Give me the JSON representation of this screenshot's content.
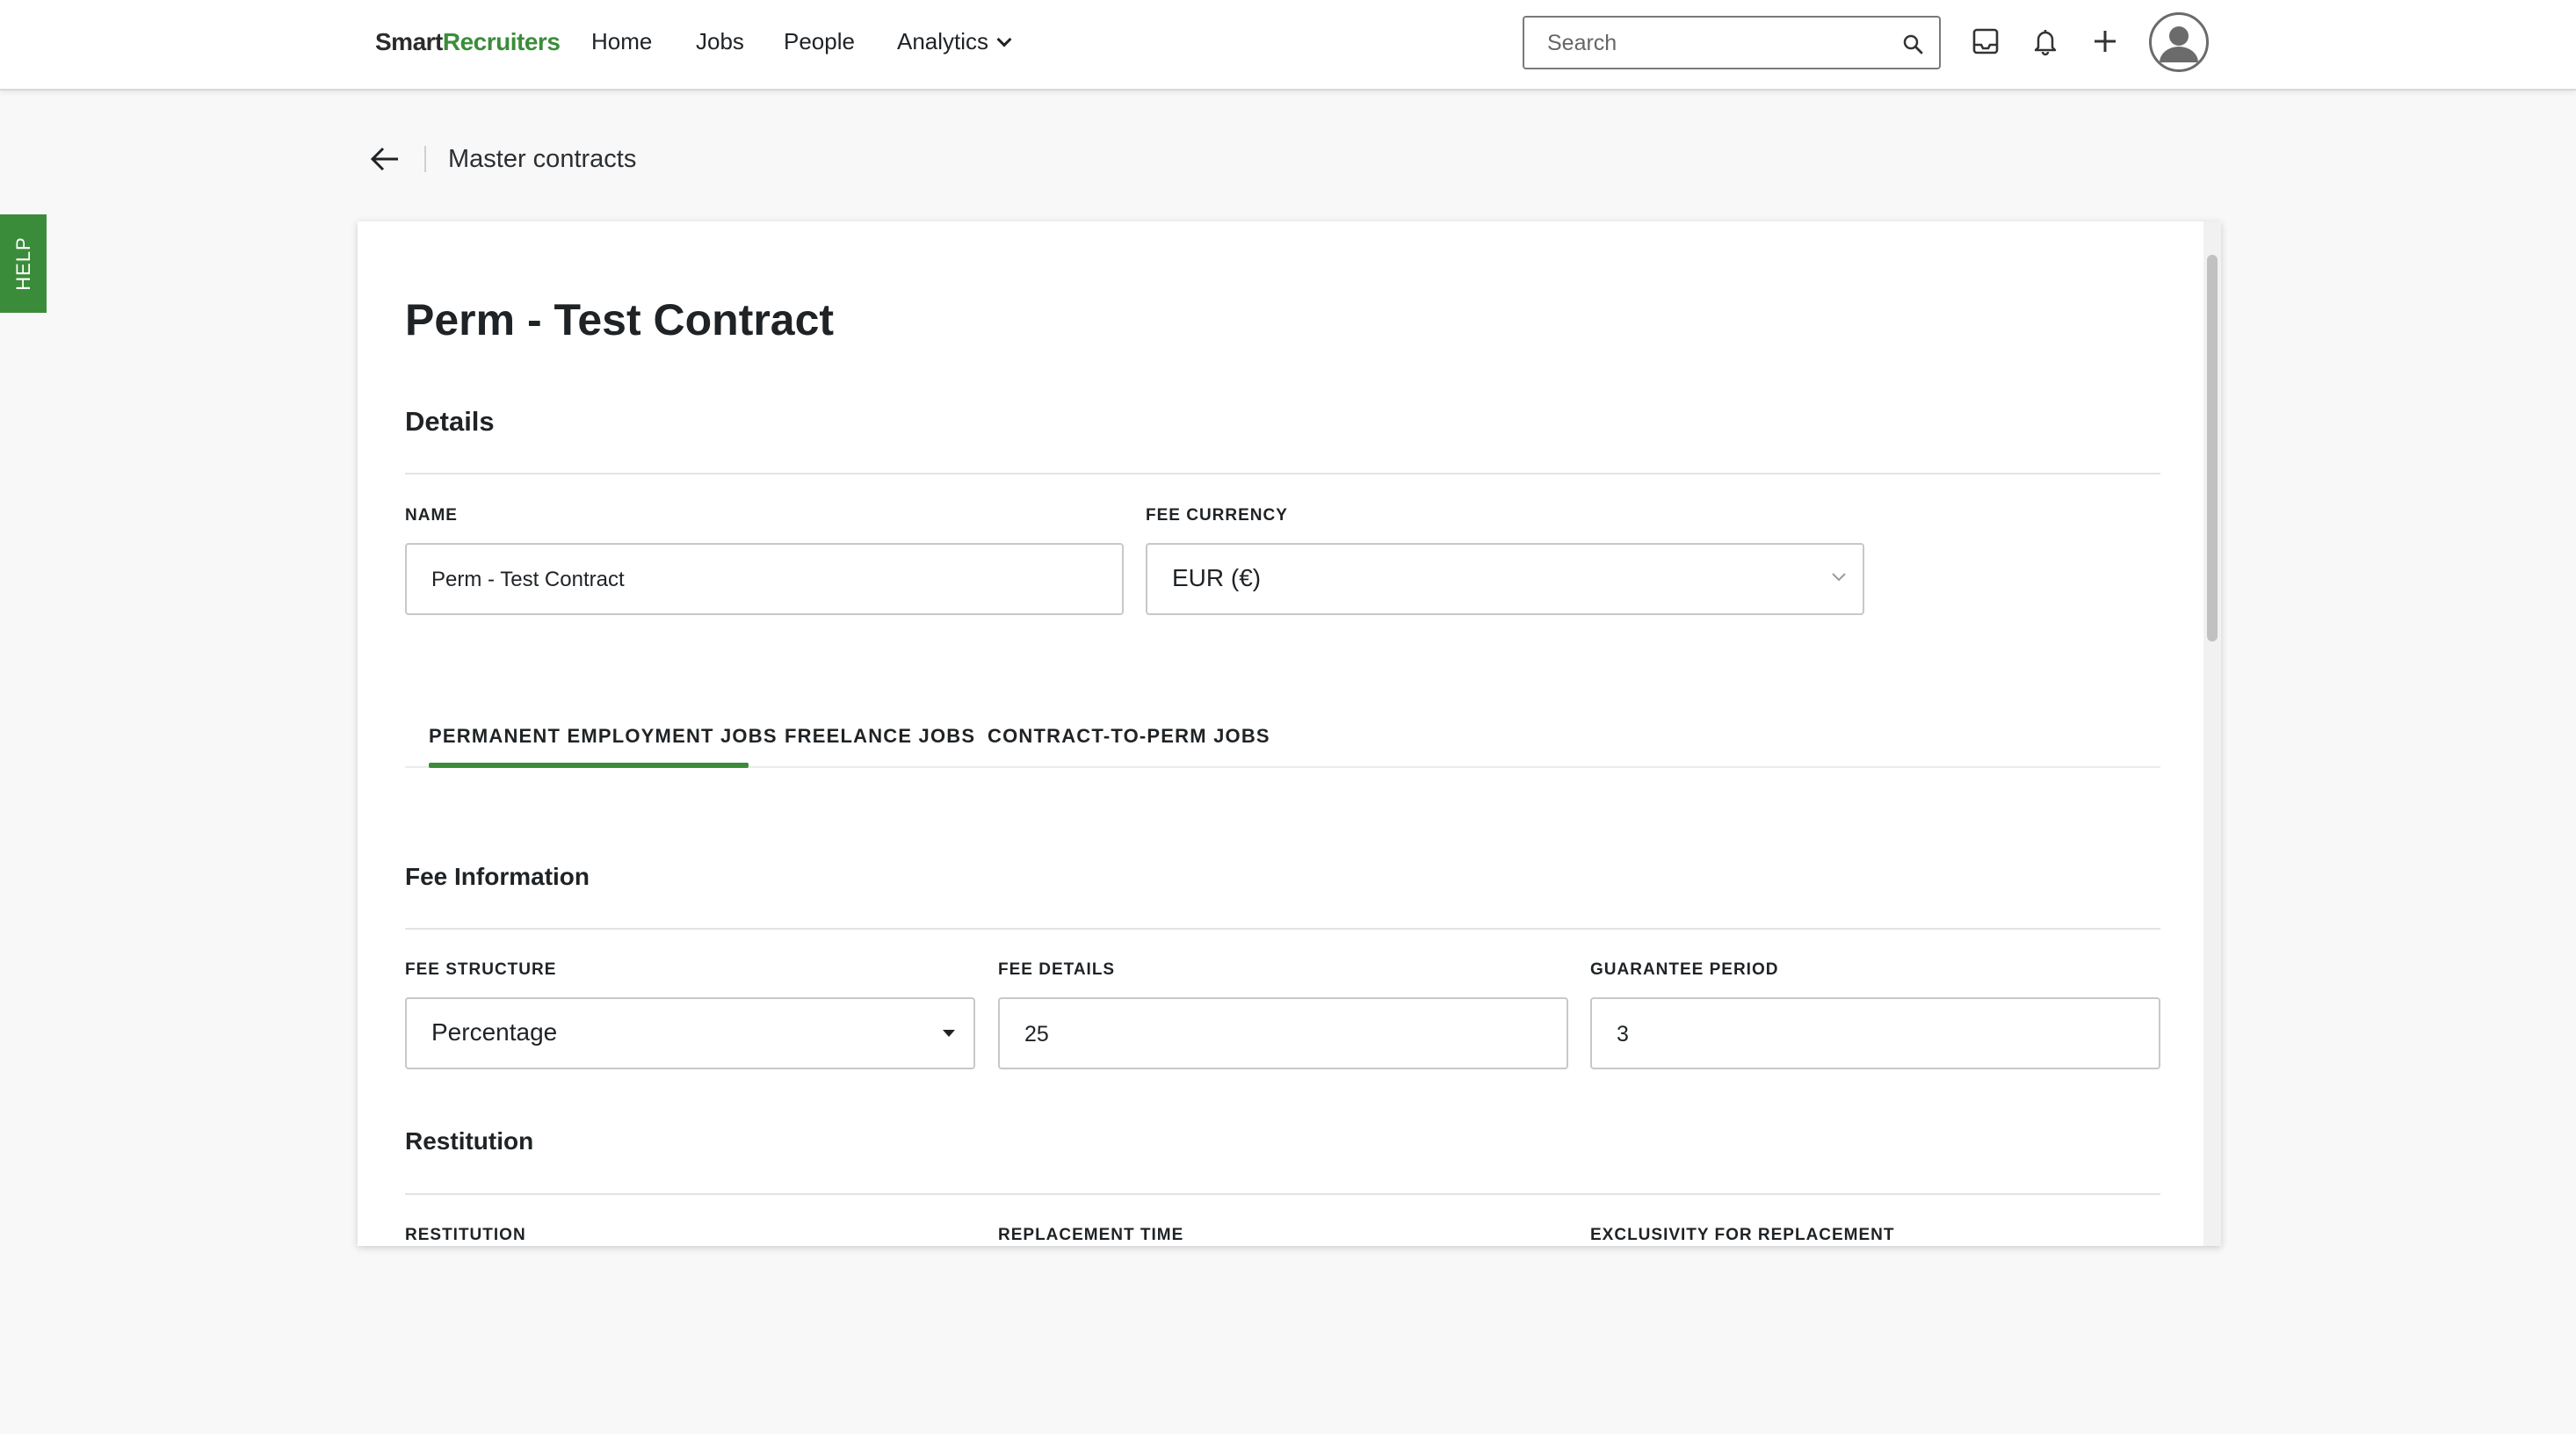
{
  "header": {
    "logo_part1": "Smart",
    "logo_part2": "Recruiters",
    "nav": [
      "Home",
      "Jobs",
      "People",
      "Analytics"
    ],
    "search_placeholder": "Search"
  },
  "help_label": "HELP",
  "breadcrumb": {
    "title": "Master contracts"
  },
  "contract": {
    "title": "Perm - Test Contract",
    "details_heading": "Details",
    "name_label": "NAME",
    "name_value": "Perm - Test Contract",
    "currency_label": "FEE CURRENCY",
    "currency_value": "EUR (€)"
  },
  "tabs": [
    "PERMANENT EMPLOYMENT JOBS",
    "FREELANCE JOBS",
    "CONTRACT-TO-PERM JOBS"
  ],
  "fee_info": {
    "heading": "Fee Information",
    "structure_label": "FEE STRUCTURE",
    "structure_value": "Percentage",
    "details_label": "FEE DETAILS",
    "details_value": "25",
    "guarantee_label": "GUARANTEE PERIOD",
    "guarantee_value": "3"
  },
  "restitution": {
    "heading": "Restitution",
    "labels": [
      "RESTITUTION",
      "REPLACEMENT TIME",
      "EXCLUSIVITY FOR REPLACEMENT"
    ]
  },
  "colors": {
    "brand_green": "#3b8c3a",
    "text": "#1f2326"
  }
}
